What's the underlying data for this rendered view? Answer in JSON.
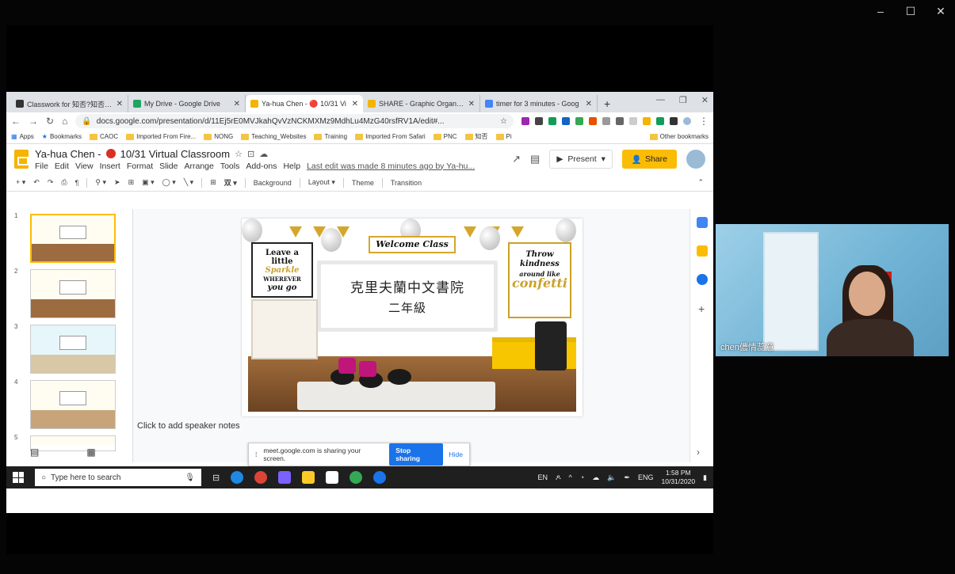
{
  "window": {
    "minimize": "–",
    "maximize": "☐",
    "close": "✕"
  },
  "chrome": {
    "tabs": [
      {
        "title": "Classwork for 知否?知否?®",
        "color": "#333"
      },
      {
        "title": "My Drive - Google Drive",
        "color": "#1fa463"
      },
      {
        "title": "Ya-hua Chen - 🔴 10/31 Vi",
        "color": "#f4b400"
      },
      {
        "title": "SHARE - Graphic Organizer",
        "color": "#f4b400"
      },
      {
        "title": "timer for 3 minutes - Goog",
        "color": "#4285f4"
      }
    ],
    "new_tab": "+",
    "url": "docs.google.com/presentation/d/11Ej5rE0MVJkahQvVzNCKMXMz9MdhLu4MzG40rsfRV1A/edit#...",
    "bookmarks": [
      "Apps",
      "Bookmarks",
      "CAOC",
      "Imported From Fire...",
      "NONG",
      "Teaching_Websites",
      "Training",
      "Imported From Safari",
      "PNC",
      "知否",
      "Pi"
    ],
    "other_bookmarks": "Other bookmarks"
  },
  "slides": {
    "title": "Ya-hua Chen -",
    "title_suffix": "10/31 Virtual Classroom",
    "menus": [
      "File",
      "Edit",
      "View",
      "Insert",
      "Format",
      "Slide",
      "Arrange",
      "Tools",
      "Add-ons",
      "Help"
    ],
    "last_edit": "Last edit was made 8 minutes ago by Ya-hu...",
    "present": "Present",
    "share": "Share",
    "toolbar": {
      "background": "Background",
      "layout": "Layout ▾",
      "theme": "Theme",
      "transition": "Transition"
    },
    "thumb_numbers": [
      "1",
      "2",
      "3",
      "4",
      "5"
    ],
    "slide": {
      "line1": "克里夫蘭中文書院",
      "line2": "二年級",
      "welcome": "Welcome Class",
      "left_poster": [
        "Leave a",
        "little",
        "Sparkle",
        "WHEREVER",
        "you go"
      ],
      "right_poster": [
        "Throw",
        "kindness",
        "around like",
        "confetti"
      ]
    },
    "speaker_notes": "Click to add speaker notes"
  },
  "share_banner": {
    "text": "meet.google.com is sharing your screen.",
    "stop": "Stop sharing",
    "hide": "Hide"
  },
  "taskbar": {
    "search_placeholder": "Type here to search",
    "lang": "ENG",
    "time": "1:58 PM",
    "date": "10/31/2020",
    "input": "EN"
  },
  "participant": {
    "name": "chen儂情蕊意"
  }
}
